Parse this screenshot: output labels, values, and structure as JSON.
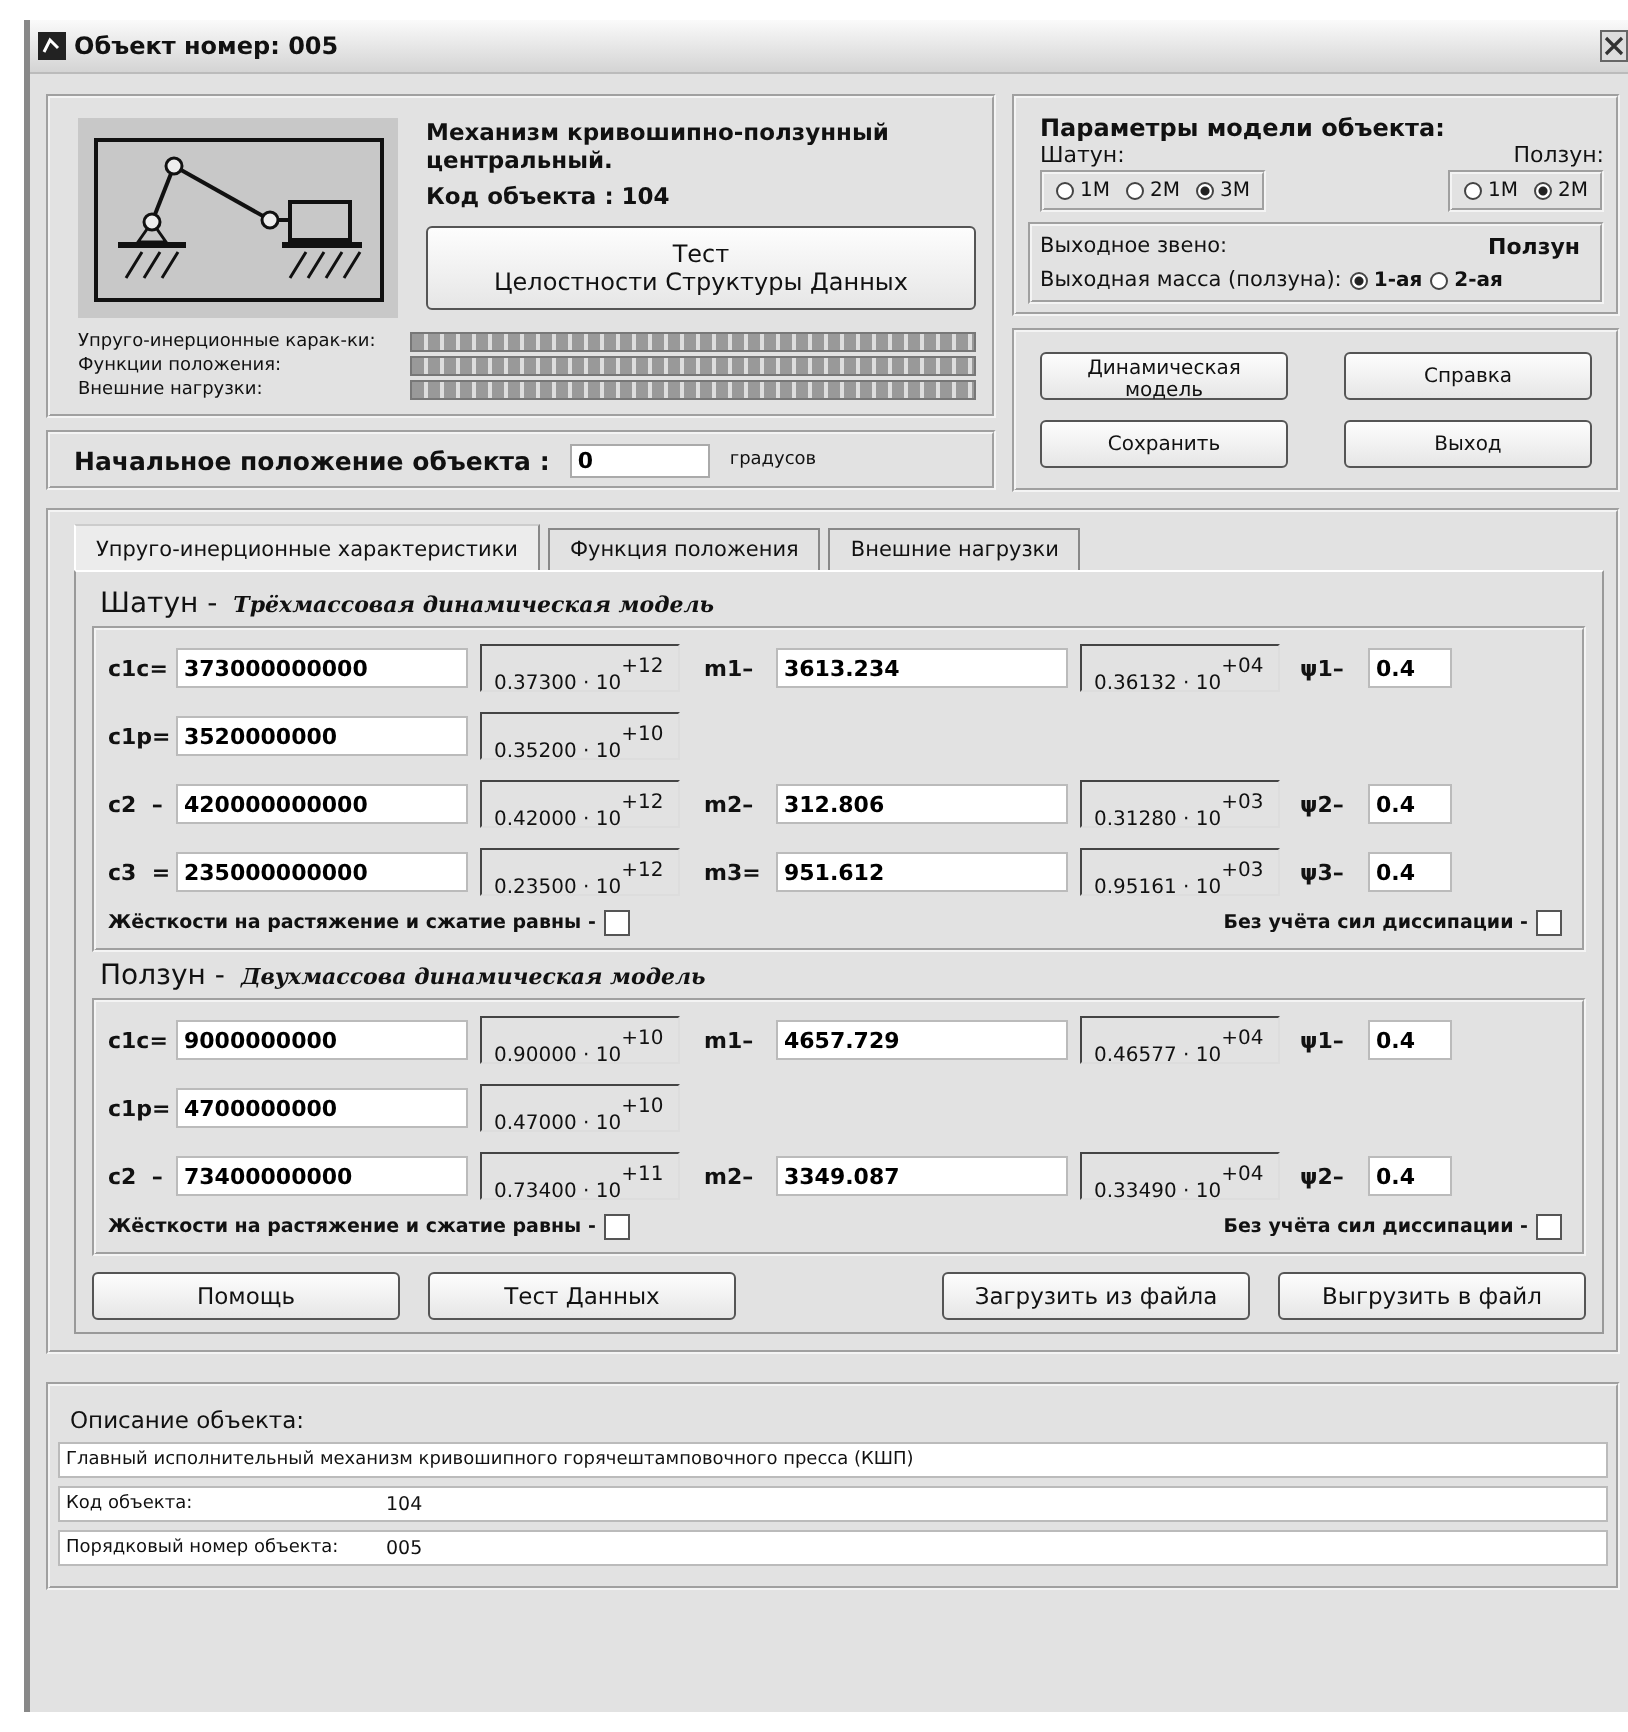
{
  "window": {
    "title": "Объект номер:  005"
  },
  "object": {
    "name": "Механизм кривошипно-ползунный центральный.",
    "code": "Код объекта : 104",
    "test_button": "Тест\nЦелостности Структуры Данных"
  },
  "progress": [
    {
      "label": "Упруго-инерционные карак-ки:",
      "level": 1
    },
    {
      "label": "Функции положения:",
      "level": 1
    },
    {
      "label": "Внешние нагрузки:",
      "level": 1
    }
  ],
  "params": {
    "title": "Параметры модели объекта:",
    "groups": [
      {
        "label": "Шатун:",
        "options": [
          {
            "label": "1М",
            "selected": false
          },
          {
            "label": "2М",
            "selected": false
          },
          {
            "label": "3М",
            "selected": true
          }
        ]
      },
      {
        "label": "Ползун:",
        "options": [
          {
            "label": "1М",
            "selected": false
          },
          {
            "label": "2М",
            "selected": true
          }
        ]
      }
    ],
    "output_link_label": "Выходное звено:",
    "output_link_value": "Ползун",
    "output_mass_label": "Выходная масса (ползуна):",
    "output_mass_options": [
      {
        "label": "1-ая",
        "selected": true
      },
      {
        "label": "2-ая",
        "selected": false
      }
    ]
  },
  "action_buttons": [
    "Динамическая модель",
    "Справка",
    "Сохранить",
    "Выход"
  ],
  "start_position": {
    "label": "Начальное положение объекта :",
    "value": "0",
    "unit": "градусов"
  },
  "tabs": [
    {
      "label": "Упруго-инерционные характеристики",
      "selected": true
    },
    {
      "label": "Функция положения",
      "selected": false
    },
    {
      "label": "Внешние нагрузки",
      "selected": false
    }
  ],
  "sections": [
    {
      "title": "Шатун -",
      "subtitle": "Трёхмассовая динамическая модель",
      "rows": [
        {
          "label": "c1c=",
          "value": "373000000000",
          "sci": "0.37300 · 10$^{+12}$",
          "mass": {
            "label": "m1–",
            "value": "3613.234",
            "sci": "0.36132 · 10$^{+04}$"
          },
          "psi": {
            "label": "ψ1–",
            "value": "0.4"
          }
        },
        {
          "label": "c1p=",
          "value": "3520000000",
          "sci": "0.35200 · 10$^{+10}$"
        },
        {
          "label": "c2  –",
          "value": "420000000000",
          "sci": "0.42000 · 10$^{+12}$",
          "mass": {
            "label": "m2–",
            "value": "312.806",
            "sci": "0.31280 · 10$^{+03}$"
          },
          "psi": {
            "label": "ψ2–",
            "value": "0.4"
          }
        },
        {
          "label": "c3  =",
          "value": "235000000000",
          "sci": "0.23500 · 10$^{+12}$",
          "mass": {
            "label": "m3=",
            "value": "951.612",
            "sci": "0.95161 · 10$^{+03}$"
          },
          "psi": {
            "label": "ψ3–",
            "value": "0.4"
          }
        }
      ],
      "equal_label": "Жёсткости на растяжение и сжатие равны -",
      "equal_checked": false,
      "dissipation_label": "Без учёта сил диссипации -",
      "dissipation_checked": false
    },
    {
      "title": "Ползун -",
      "subtitle": "Двухмассова динамическая модель",
      "rows": [
        {
          "label": "c1c=",
          "value": "9000000000",
          "sci": "0.90000 · 10$^{+10}$",
          "mass": {
            "label": "m1–",
            "value": "4657.729",
            "sci": "0.46577 · 10$^{+04}$"
          },
          "psi": {
            "label": "ψ1–",
            "value": "0.4"
          }
        },
        {
          "label": "c1p=",
          "value": "4700000000",
          "sci": "0.47000 · 10$^{+10}$"
        },
        {
          "label": "c2  –",
          "value": "73400000000",
          "sci": "0.73400 · 10$^{+11}$",
          "mass": {
            "label": "m2–",
            "value": "3349.087",
            "sci": "0.33490 · 10$^{+04}$"
          },
          "psi": {
            "label": "ψ2–",
            "value": "0.4"
          }
        }
      ],
      "equal_label": "Жёсткости на растяжение и сжатие равны -",
      "equal_checked": false,
      "dissipation_label": "Без учёта сил диссипации -",
      "dissipation_checked": false
    }
  ],
  "bottom_buttons": [
    "Помощь",
    "Тест Данных",
    "Загрузить из файла",
    "Выгрузить в файл"
  ],
  "description": {
    "title": "Описание объекта:",
    "lines": [
      {
        "label": "Главный исполнительный механизм кривошипного горячештамповочного пресса (КШП)"
      },
      {
        "label": "Код объекта:",
        "value": "104"
      },
      {
        "label": "Порядковый номер объекта:",
        "value": "005"
      }
    ]
  }
}
